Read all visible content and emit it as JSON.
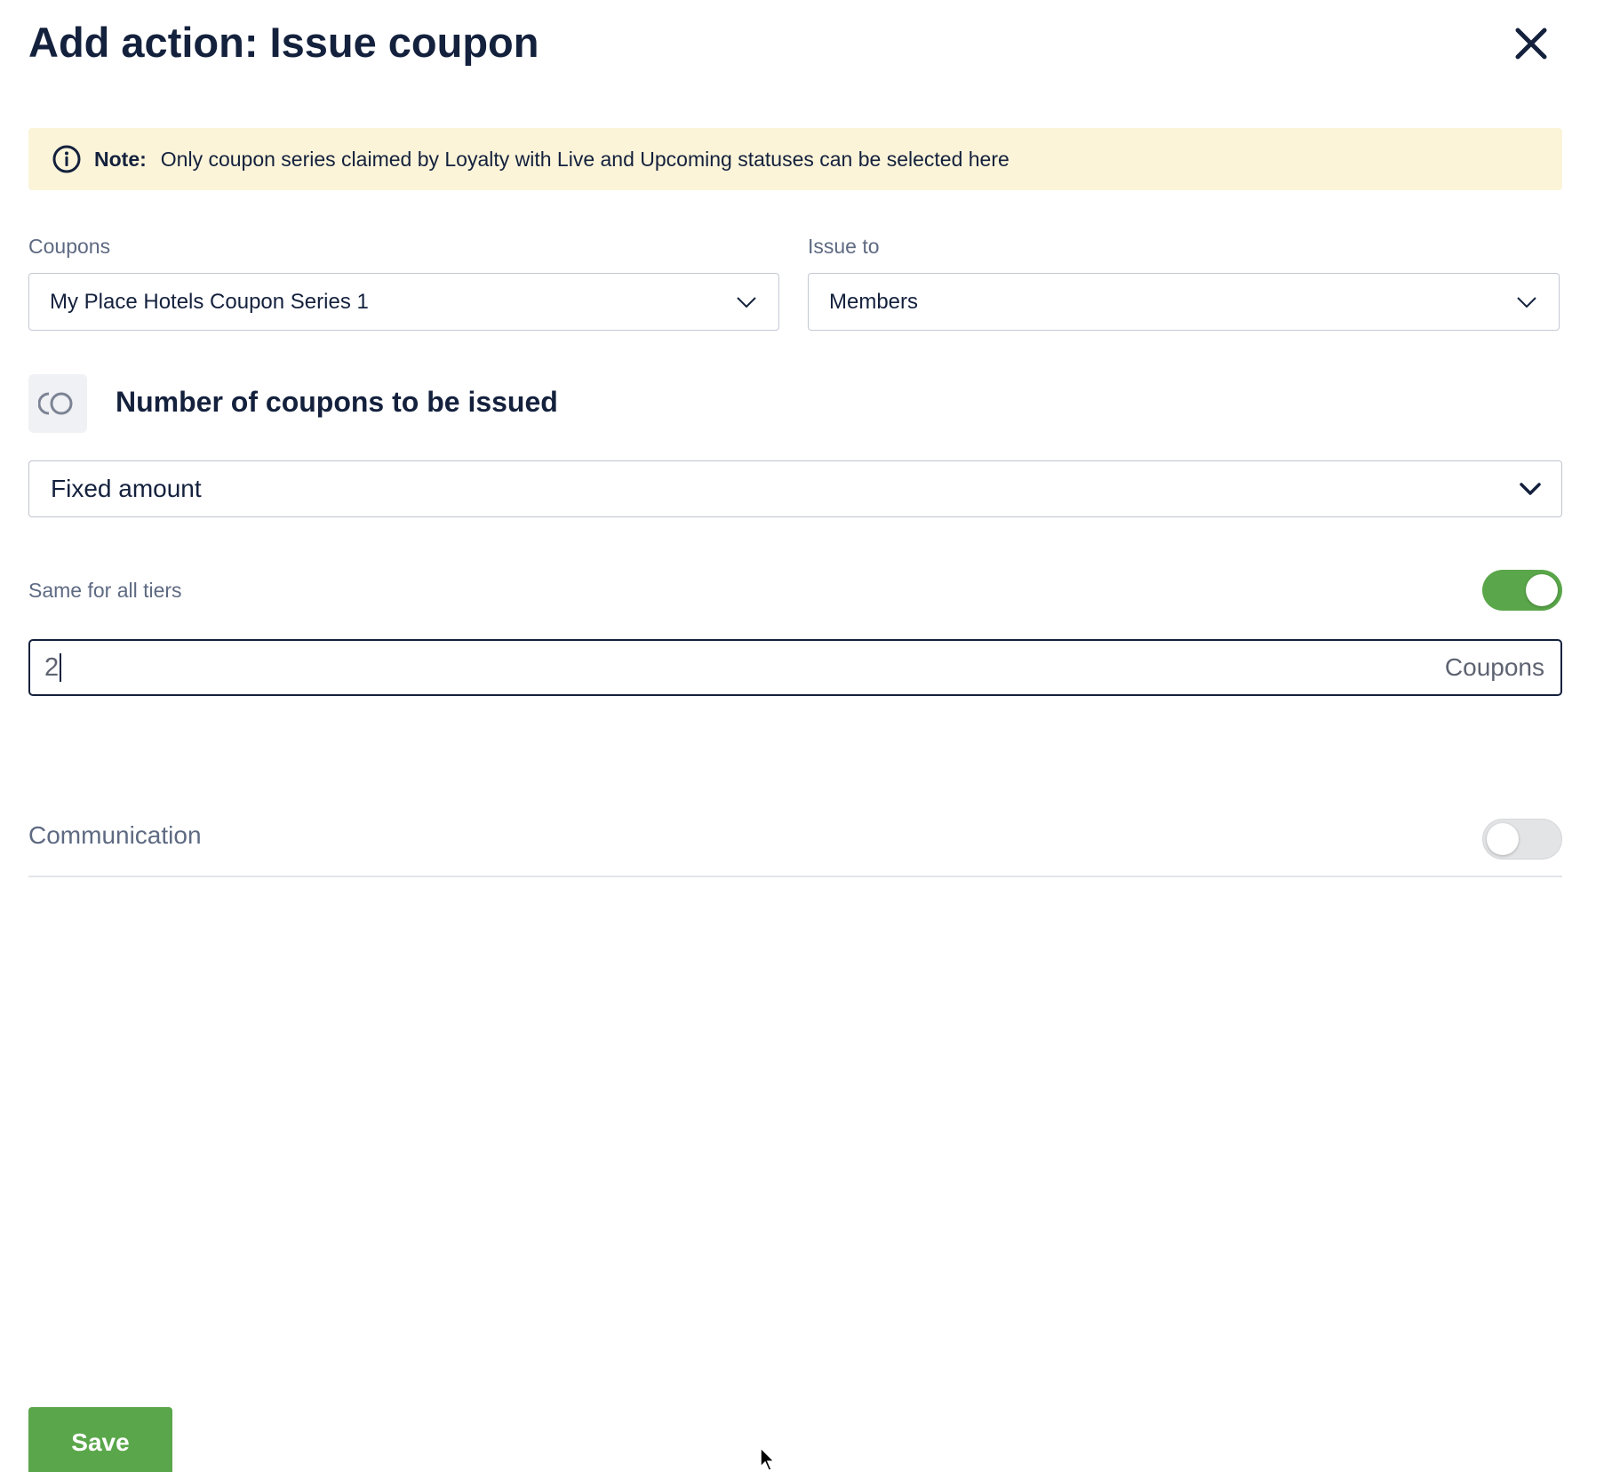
{
  "dialog": {
    "title": "Add action: Issue coupon"
  },
  "note": {
    "label": "Note:",
    "text": "Only coupon series claimed by Loyalty with Live and Upcoming statuses can be selected here",
    "background": "#fbf4d9"
  },
  "coupons_field": {
    "label": "Coupons",
    "selected": "My Place Hotels Coupon Series 1"
  },
  "issue_to_field": {
    "label": "Issue to",
    "selected": "Members"
  },
  "number_section": {
    "title": "Number of coupons to be issued",
    "icon": "coupons-icon"
  },
  "amount_type": {
    "selected": "Fixed amount"
  },
  "same_for_all_tiers": {
    "label": "Same for all tiers",
    "enabled": true
  },
  "quantity_input": {
    "value": "2",
    "suffix": "Coupons"
  },
  "communication": {
    "label": "Communication",
    "enabled": false
  },
  "footer": {
    "save_label": "Save"
  },
  "colors": {
    "accent_green": "#5aa64a",
    "heading": "#14213d",
    "muted_text": "#5e6a82"
  }
}
